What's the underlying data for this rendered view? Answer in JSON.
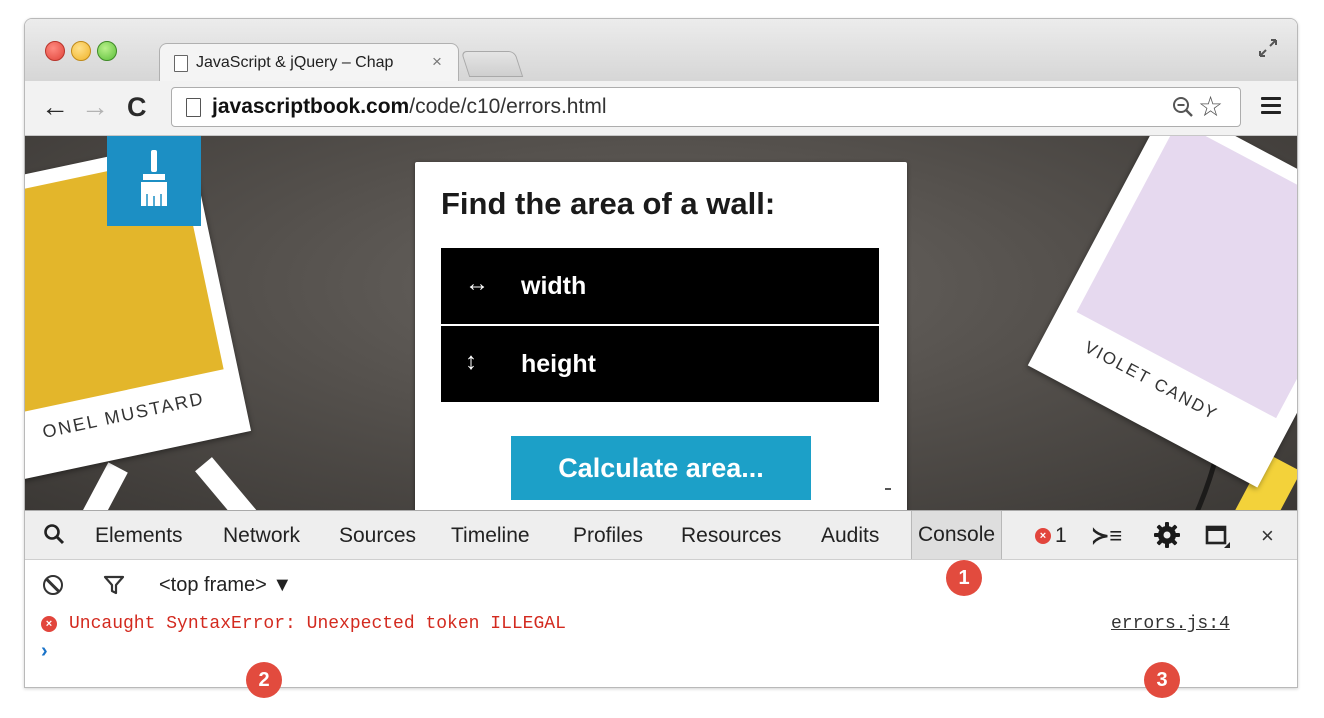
{
  "browser": {
    "tab": {
      "title": "JavaScript & jQuery – Chap",
      "close": "×"
    },
    "address": {
      "domain": "javascriptbook.com",
      "path": "/code/c10/errors.html"
    }
  },
  "page": {
    "heading": "Find the area of a wall:",
    "fields": [
      {
        "icon": "↔",
        "label": "width"
      },
      {
        "icon": "↕",
        "label": "height"
      }
    ],
    "calc_button": "Calculate area...",
    "swatch_left_label": "ONEL MUSTARD",
    "swatch_right_label": "VIOLET CANDY",
    "colors": {
      "mustard": "#e3b62b",
      "violet": "#e6d9ef",
      "brand_blue": "#1c8fc4",
      "button": "#1ca0c8"
    }
  },
  "devtools": {
    "tabs": [
      "Elements",
      "Network",
      "Sources",
      "Timeline",
      "Profiles",
      "Resources",
      "Audits",
      "Console"
    ],
    "active_tab": "Console",
    "error_count": "1",
    "frame_select": "<top frame> ▼",
    "console": {
      "error_message": "Uncaught SyntaxError: Unexpected token ILLEGAL",
      "error_source": "errors.js:4",
      "prompt": "›"
    }
  },
  "annotations": [
    "1",
    "2",
    "3"
  ]
}
